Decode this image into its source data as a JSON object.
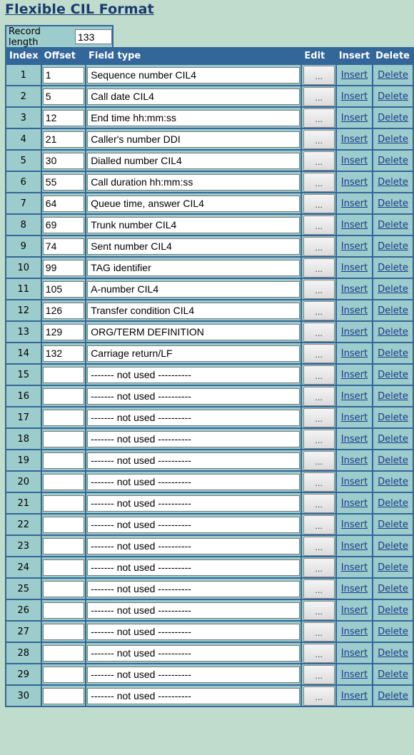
{
  "page": {
    "title": "Flexible CIL Format"
  },
  "record_length": {
    "label": "Record length",
    "value": "133"
  },
  "table": {
    "headers": {
      "index": "Index",
      "offset": "Offset",
      "field_type": "Field type",
      "edit": "Edit",
      "insert": "Insert",
      "delete": "Delete"
    },
    "edit_label": "...",
    "insert_label": "Insert",
    "delete_label": "Delete",
    "rows": [
      {
        "index": "1",
        "offset": "1",
        "field_type": "Sequence number CIL4"
      },
      {
        "index": "2",
        "offset": "5",
        "field_type": "Call date CIL4"
      },
      {
        "index": "3",
        "offset": "12",
        "field_type": "End time hh:mm:ss"
      },
      {
        "index": "4",
        "offset": "21",
        "field_type": "Caller's number DDI"
      },
      {
        "index": "5",
        "offset": "30",
        "field_type": "Dialled number CIL4"
      },
      {
        "index": "6",
        "offset": "55",
        "field_type": "Call duration hh:mm:ss"
      },
      {
        "index": "7",
        "offset": "64",
        "field_type": "Queue time, answer CIL4"
      },
      {
        "index": "8",
        "offset": "69",
        "field_type": "Trunk number CIL4"
      },
      {
        "index": "9",
        "offset": "74",
        "field_type": "Sent number CIL4"
      },
      {
        "index": "10",
        "offset": "99",
        "field_type": "TAG identifier"
      },
      {
        "index": "11",
        "offset": "105",
        "field_type": "A-number CIL4"
      },
      {
        "index": "12",
        "offset": "126",
        "field_type": "Transfer condition CIL4"
      },
      {
        "index": "13",
        "offset": "129",
        "field_type": "ORG/TERM DEFINITION"
      },
      {
        "index": "14",
        "offset": "132",
        "field_type": "Carriage return/LF"
      },
      {
        "index": "15",
        "offset": "",
        "field_type": "------- not used ----------"
      },
      {
        "index": "16",
        "offset": "",
        "field_type": "------- not used ----------"
      },
      {
        "index": "17",
        "offset": "",
        "field_type": "------- not used ----------"
      },
      {
        "index": "18",
        "offset": "",
        "field_type": "------- not used ----------"
      },
      {
        "index": "19",
        "offset": "",
        "field_type": "------- not used ----------"
      },
      {
        "index": "20",
        "offset": "",
        "field_type": "------- not used ----------"
      },
      {
        "index": "21",
        "offset": "",
        "field_type": "------- not used ----------"
      },
      {
        "index": "22",
        "offset": "",
        "field_type": "------- not used ----------"
      },
      {
        "index": "23",
        "offset": "",
        "field_type": "------- not used ----------"
      },
      {
        "index": "24",
        "offset": "",
        "field_type": "------- not used ----------"
      },
      {
        "index": "25",
        "offset": "",
        "field_type": "------- not used ----------"
      },
      {
        "index": "26",
        "offset": "",
        "field_type": "------- not used ----------"
      },
      {
        "index": "27",
        "offset": "",
        "field_type": "------- not used ----------"
      },
      {
        "index": "28",
        "offset": "",
        "field_type": "------- not used ----------"
      },
      {
        "index": "29",
        "offset": "",
        "field_type": "------- not used ----------"
      },
      {
        "index": "30",
        "offset": "",
        "field_type": "------- not used ----------"
      }
    ]
  }
}
